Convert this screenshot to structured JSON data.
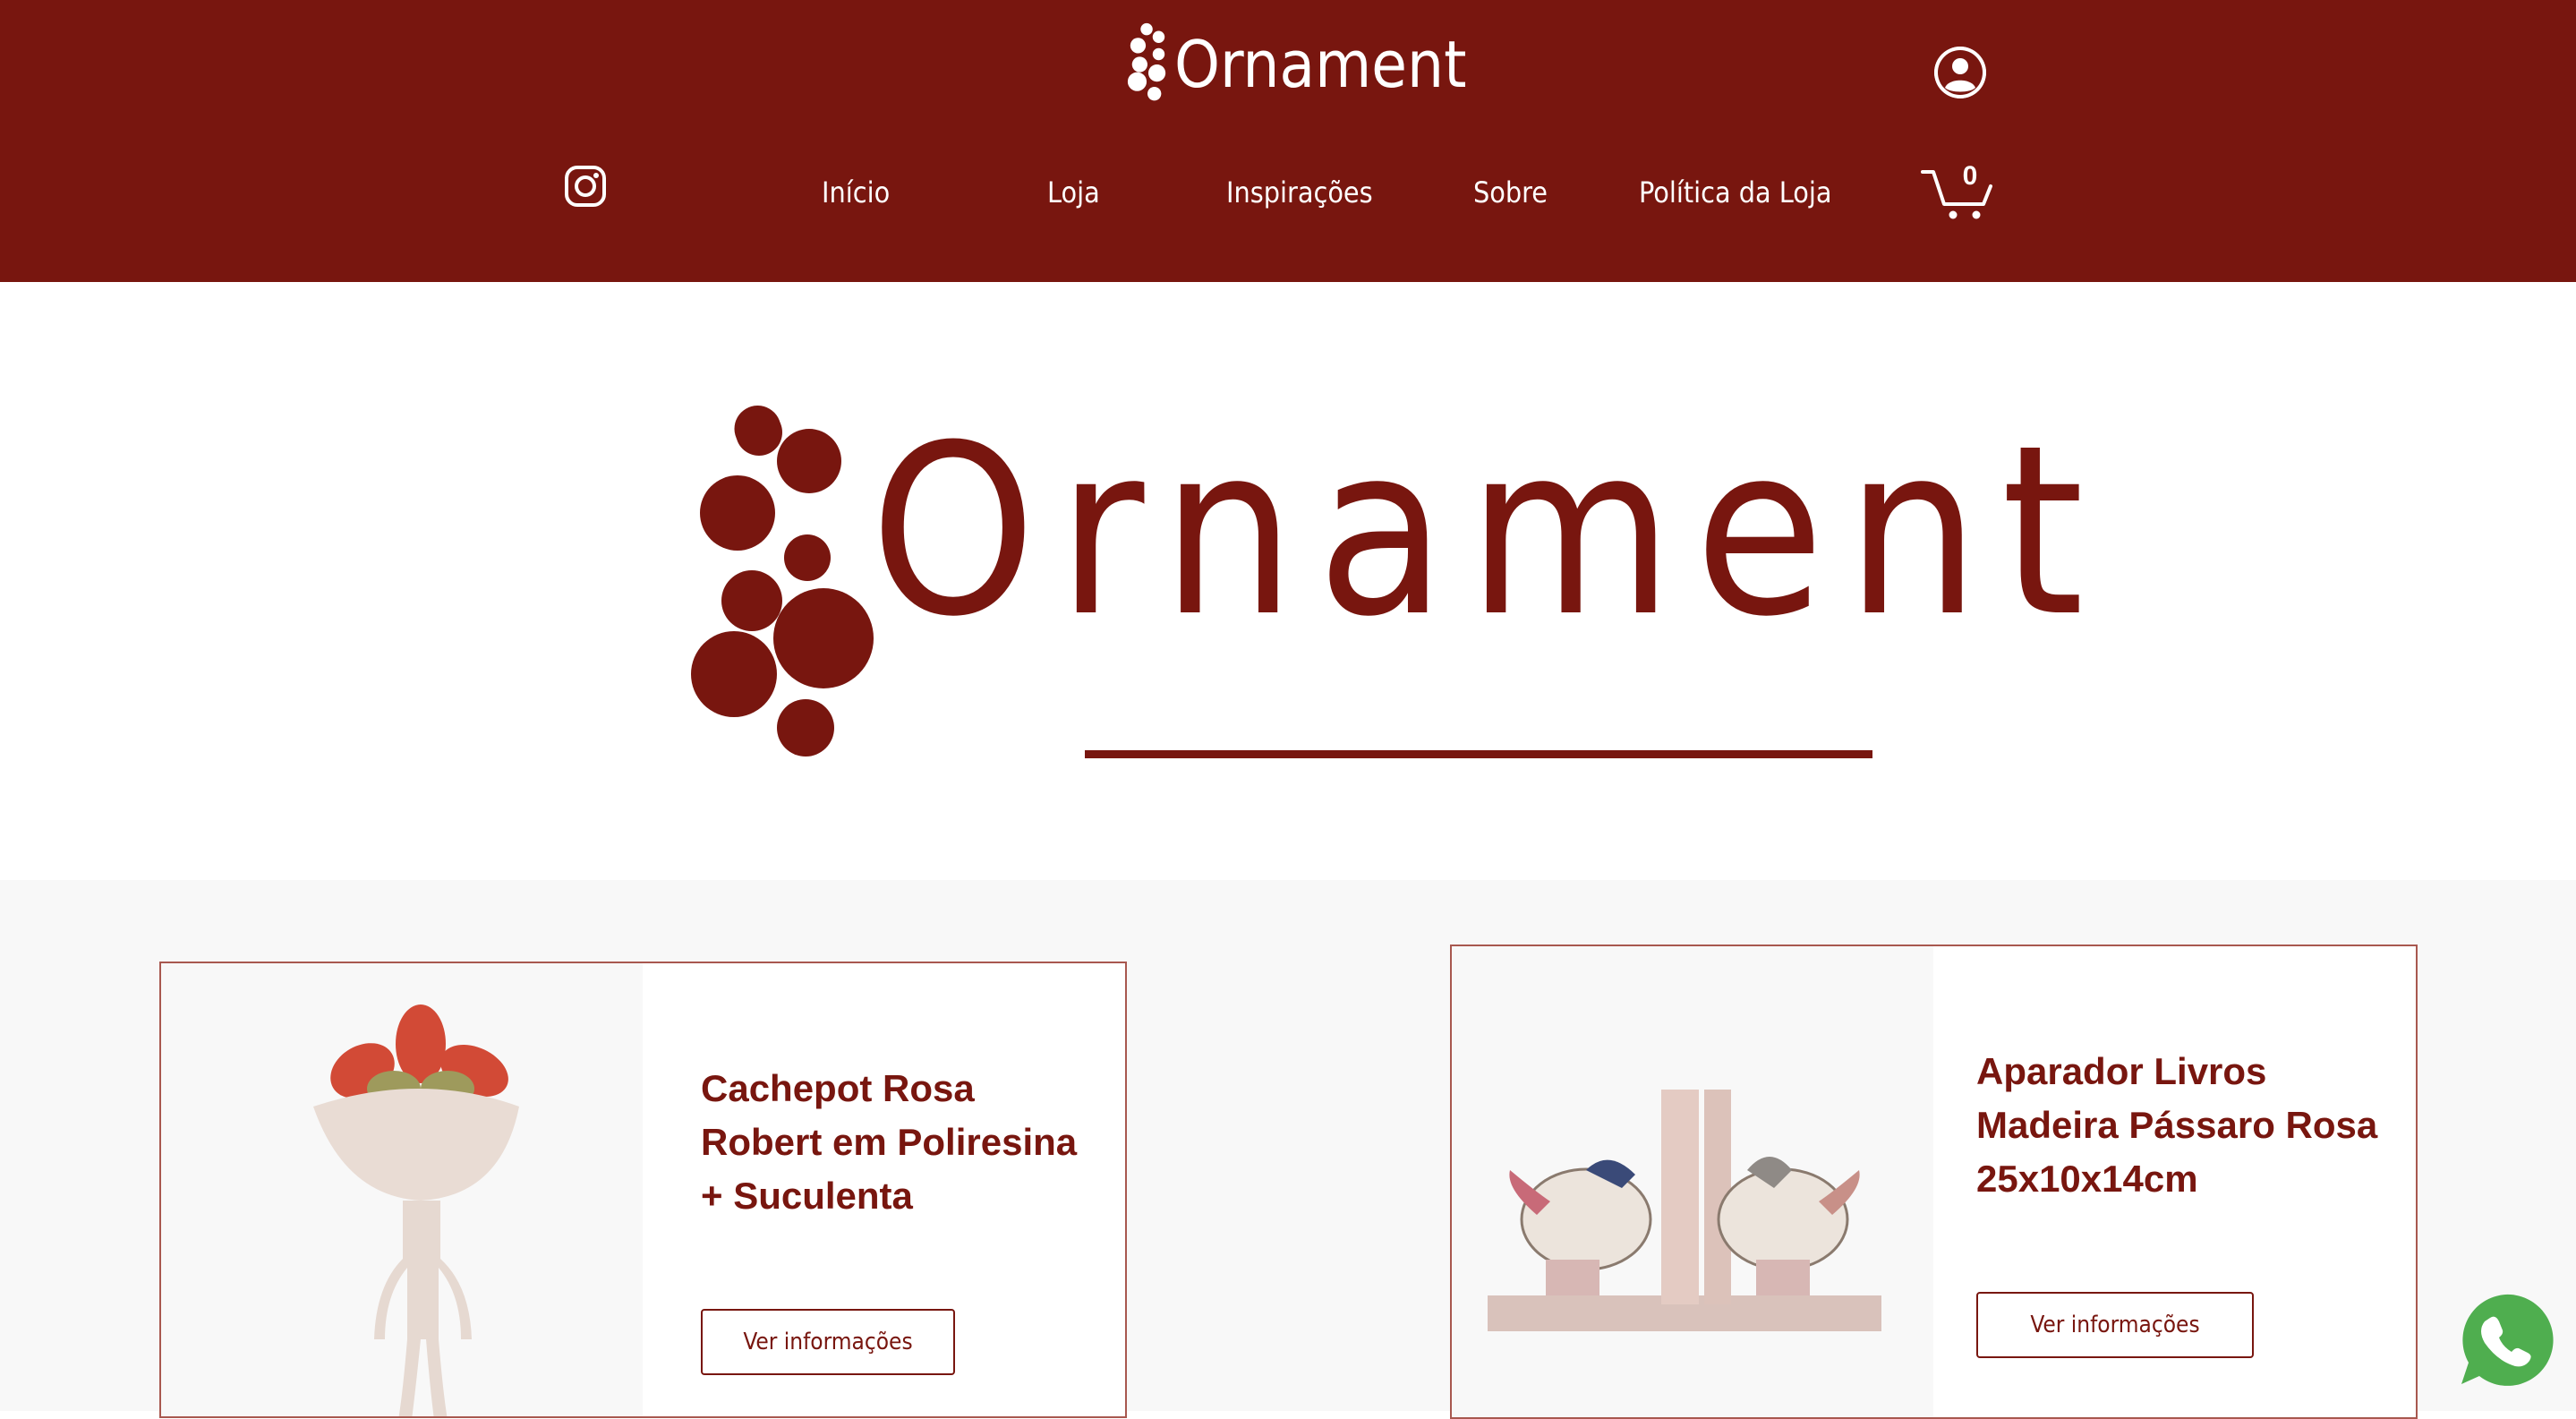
{
  "brand": {
    "name": "Ornament",
    "color": "#78160f"
  },
  "header": {
    "nav": [
      "Início",
      "Loja",
      "Inspirações",
      "Sobre",
      "Política da Loja"
    ],
    "cart_count": "0",
    "icons": {
      "account": "account-icon",
      "social": "instagram-icon",
      "cart": "cart-icon"
    }
  },
  "hero": {
    "logo_text": "Ornament"
  },
  "products": [
    {
      "title": "Cachepot Rosa Robert em Poliresina + Suculenta",
      "button_label": "Ver informações"
    },
    {
      "title": "Aparador Livros Madeira Pássaro Rosa 25x10x14cm",
      "button_label": "Ver informações"
    }
  ],
  "floating": {
    "icon": "whatsapp-icon",
    "color": "#4fae4f"
  }
}
